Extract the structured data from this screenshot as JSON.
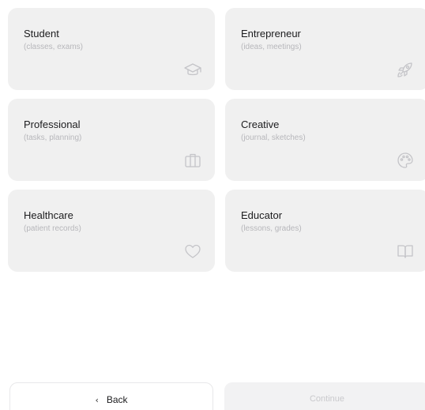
{
  "options": [
    {
      "title": "Student",
      "subtitle": "(classes, exams)",
      "icon": "graduation-cap-icon"
    },
    {
      "title": "Entrepreneur",
      "subtitle": "(ideas, meetings)",
      "icon": "rocket-icon"
    },
    {
      "title": "Professional",
      "subtitle": "(tasks, planning)",
      "icon": "briefcase-icon"
    },
    {
      "title": "Creative",
      "subtitle": "(journal, sketches)",
      "icon": "palette-icon"
    },
    {
      "title": "Healthcare",
      "subtitle": "(patient records)",
      "icon": "heart-icon"
    },
    {
      "title": "Educator",
      "subtitle": "(lessons, grades)",
      "icon": "book-icon"
    }
  ],
  "footer": {
    "back_label": "Back",
    "back_icon": "chevron-left-icon",
    "continue_label": "Continue",
    "continue_disabled": true
  },
  "colors": {
    "card_background": "#f0f0f0",
    "icon_color": "#c4c4c8",
    "title_color": "#1c1c1e",
    "subtitle_color": "#b7b7bb"
  }
}
